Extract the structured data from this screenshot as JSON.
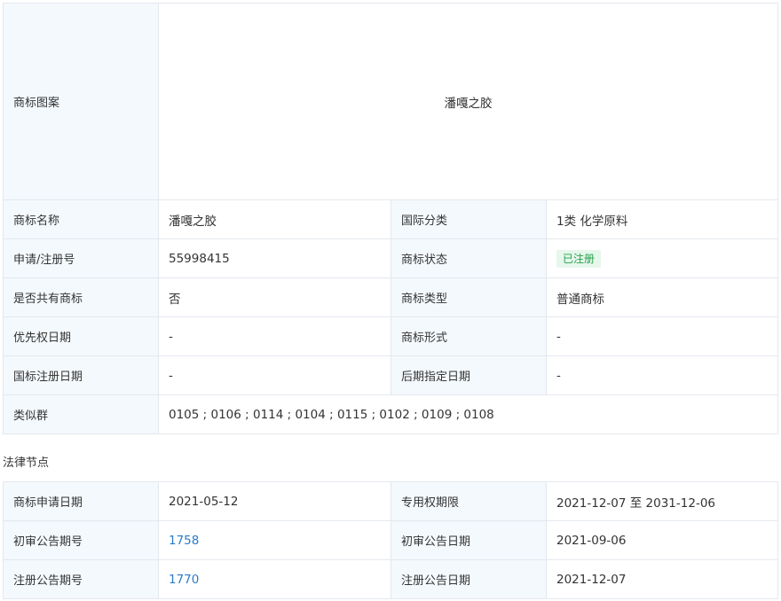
{
  "trademark": {
    "image_label": "商标图案",
    "image_text": "潘嘎之胶",
    "rows": [
      {
        "l1": "商标名称",
        "v1": "潘嘎之胶",
        "l2": "国际分类",
        "v2": "1类 化学原料"
      },
      {
        "l1": "申请/注册号",
        "v1": "55998415",
        "l2": "商标状态",
        "v2": "已注册"
      },
      {
        "l1": "是否共有商标",
        "v1": "否",
        "l2": "商标类型",
        "v2": "普通商标"
      },
      {
        "l1": "优先权日期",
        "v1": "-",
        "l2": "商标形式",
        "v2": "-"
      },
      {
        "l1": "国标注册日期",
        "v1": "-",
        "l2": "后期指定日期",
        "v2": "-"
      }
    ],
    "similar_group": {
      "label": "类似群",
      "value": "0105 ; 0106 ; 0114 ; 0104 ; 0115 ; 0102 ; 0109 ; 0108"
    }
  },
  "legal": {
    "title": "法律节点",
    "rows": [
      {
        "l1": "商标申请日期",
        "v1": "2021-05-12",
        "l2": "专用权期限",
        "v2": "2021-12-07 至 2031-12-06"
      },
      {
        "l1": "初审公告期号",
        "v1": "1758",
        "l2": "初审公告日期",
        "v2": "2021-09-06"
      },
      {
        "l1": "注册公告期号",
        "v1": "1770",
        "l2": "注册公告日期",
        "v2": "2021-12-07"
      }
    ]
  },
  "colors": {
    "label_bg": "#f4f9fd",
    "border": "#e4e8ee",
    "link": "#2b7bc8",
    "badge_bg": "#e6f7ec",
    "badge_text": "#27a04a"
  }
}
